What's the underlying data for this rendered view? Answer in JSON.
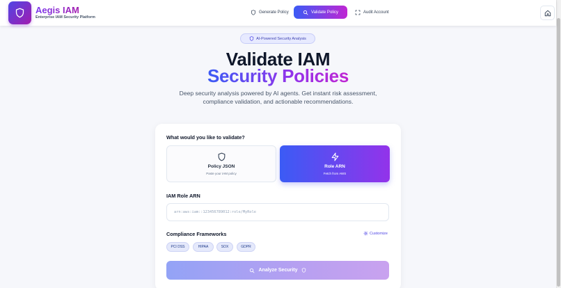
{
  "brand": {
    "title": "Aegis IAM",
    "subtitle": "Enterprise IAM Security Platform",
    "logo_icon": "shield-icon",
    "gradient": [
      "#4f46e5",
      "#a21caf"
    ]
  },
  "nav": {
    "items": [
      {
        "label": "Generate Policy",
        "icon": "shield-icon",
        "active": false
      },
      {
        "label": "Validate Policy",
        "icon": "search-icon",
        "active": true
      },
      {
        "label": "Audit Account",
        "icon": "scan-icon",
        "active": false
      }
    ],
    "home_icon": "home-icon"
  },
  "hero": {
    "badge": "AI-Powered Security Analysis",
    "title_line1": "Validate IAM",
    "title_line2": "Security Policies",
    "description_line1": "Deep security analysis powered by AI agents. Get instant risk assessment,",
    "description_line2": "compliance validation, and actionable recommendations."
  },
  "form": {
    "question": "What would you like to validate?",
    "options": [
      {
        "title": "Policy JSON",
        "subtitle": "Paste your IAM policy",
        "icon": "shield-icon",
        "selected": false
      },
      {
        "title": "Role ARN",
        "subtitle": "Fetch from AWS",
        "icon": "lightning-icon",
        "selected": true
      }
    ],
    "arn_label": "IAM Role ARN",
    "arn_placeholder": "arn:aws:iam::123456789012:role/MyRole",
    "arn_value": "",
    "frameworks_label": "Compliance Frameworks",
    "customize_label": "Customize",
    "frameworks": [
      "PCI DSS",
      "HIPAA",
      "SOX",
      "GDPR"
    ],
    "analyze_label": "Analyze Security"
  },
  "colors": {
    "accent_blue": "#3b5bf5",
    "accent_purple": "#9333ea",
    "accent_magenta": "#c026d3",
    "background": "#f6f7fb"
  }
}
